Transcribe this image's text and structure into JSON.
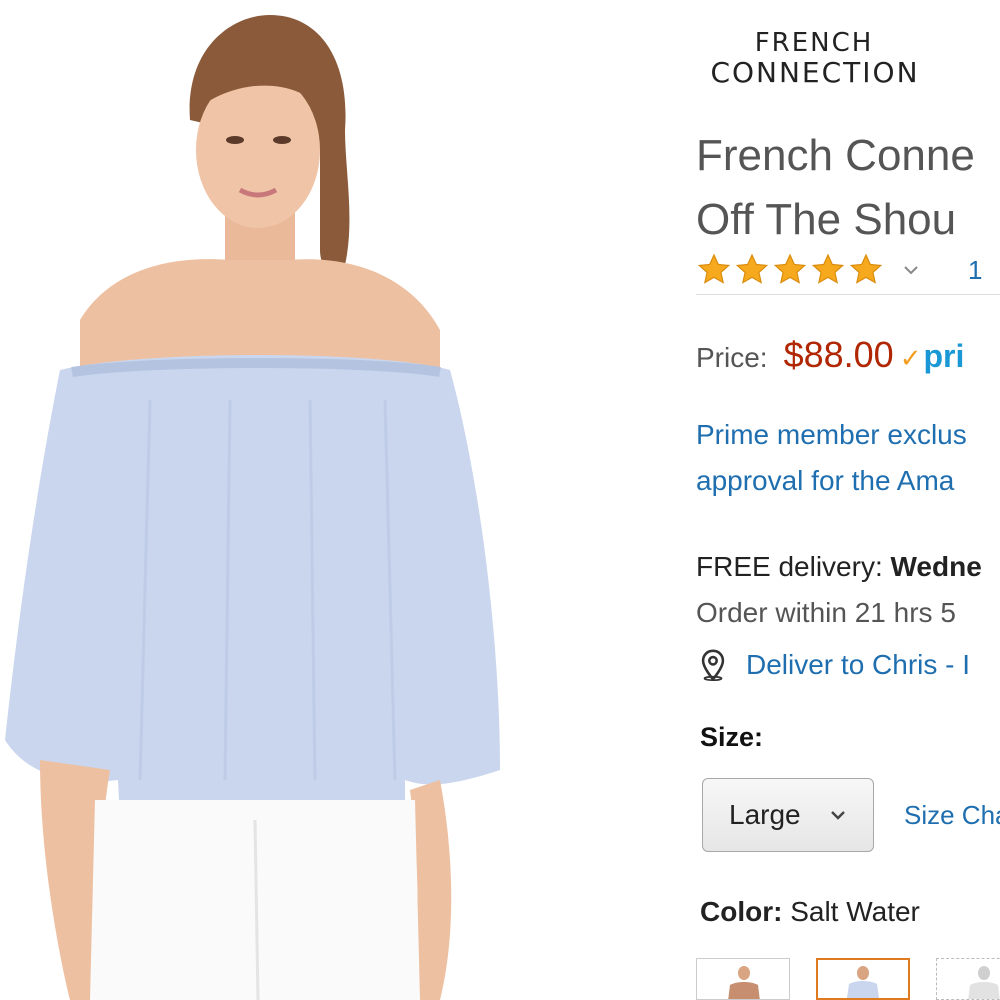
{
  "brand": {
    "line1": "FRENCH",
    "line2": "CONNECTION"
  },
  "product": {
    "title_line1": "French Conne",
    "title_line2": "Off The Shou"
  },
  "rating": {
    "stars": 5,
    "count_text": "1"
  },
  "price": {
    "label": "Price:",
    "value": "$88.00",
    "prime_check": "✓",
    "prime_text": "pri"
  },
  "prime_offer": {
    "line1": "Prime member exclus",
    "line2": "approval for the Ama"
  },
  "delivery": {
    "free_label": "FREE delivery: ",
    "free_date": "Wedne",
    "order_within": "Order within 21 hrs 5"
  },
  "deliver_to": {
    "text": "Deliver to Chris - I"
  },
  "size": {
    "label": "Size:",
    "selected": "Large",
    "chart_link": "Size Cha"
  },
  "color": {
    "label": "Color:",
    "value": " Salt Water"
  },
  "colors": {
    "price_red": "#b12704",
    "link_blue": "#1f6fb0",
    "prime_blue": "#1a98d5",
    "star_orange": "#f7a91e",
    "selected_swatch_border": "#e07a1f",
    "blouse": "#c9d6ee"
  },
  "icons": {
    "star": "star-icon",
    "chevron": "chevron-down-icon",
    "location": "map-pin-icon"
  }
}
